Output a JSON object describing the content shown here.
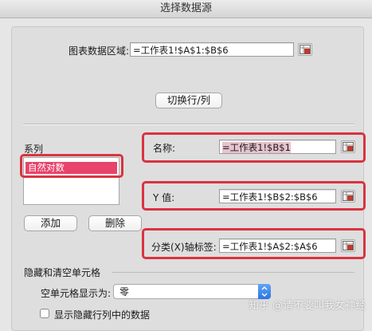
{
  "window": {
    "title": "选择数据源"
  },
  "chart_range": {
    "label": "图表数据区域:",
    "value": "=工作表1!$A$1:$B$6"
  },
  "switch_button": "切换行/列",
  "series": {
    "label": "系列",
    "items": [
      "自然对数"
    ],
    "add_label": "添加",
    "remove_label": "删除"
  },
  "name_field": {
    "label": "名称:",
    "value": "=工作表1!$B$1"
  },
  "y_field": {
    "label": "Y 值:",
    "value": "=工作表1!$B$2:$B$6"
  },
  "x_axis_field": {
    "label": "分类(X)轴标签:",
    "value": "=工作表1!$A$2:$A$6"
  },
  "hidden_empty": {
    "section_label": "隐藏和清空单元格",
    "empty_cells_label": "空单元格显示为:",
    "empty_cells_value": "零",
    "show_hidden_label": "显示隐藏行列中的数据"
  },
  "watermark": "知乎 @请不要叫我女神经",
  "colors": {
    "highlight": "#d93340",
    "selection": "#e8436a"
  }
}
